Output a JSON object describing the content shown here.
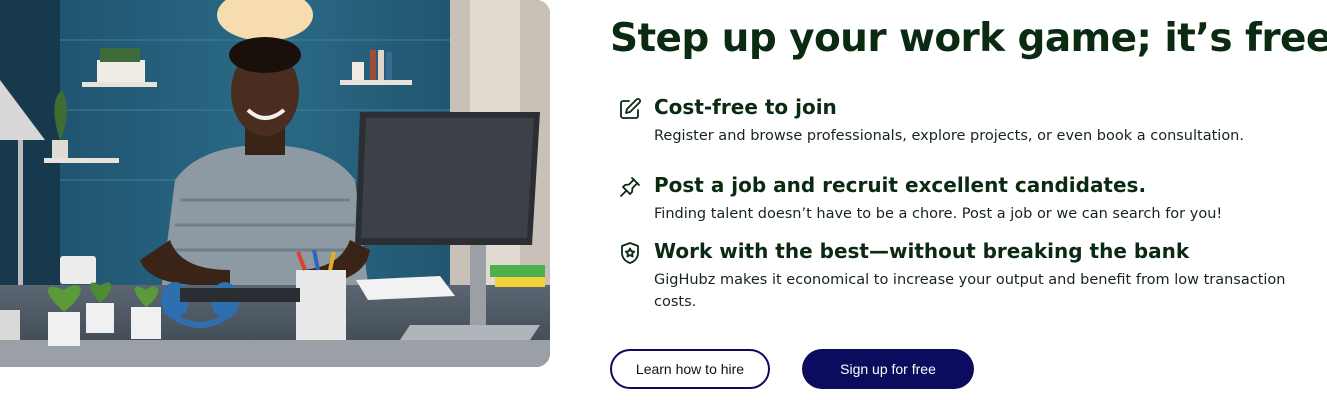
{
  "headline": "Step up your work game; it’s free.",
  "features": [
    {
      "icon": "edit-icon",
      "title": "Cost-free to join",
      "description": "Register and browse professionals, explore projects, or even book a consultation."
    },
    {
      "icon": "pin-icon",
      "title": "Post a job and recruit excellent candidates.",
      "description": "Finding talent doesn’t have to be a chore. Post a job or we can search for you!"
    },
    {
      "icon": "shield-star-icon",
      "title": "Work with the best—without breaking the bank",
      "description": "GigHubz makes it economical to increase your output and benefit from low transaction costs."
    }
  ],
  "buttons": {
    "learn_hire": "Learn how to hire",
    "signup": "Sign up for free"
  },
  "colors": {
    "heading": "#0a2a12",
    "primary_navy": "#0c0c5e",
    "outline_border": "#0d0d5c"
  }
}
